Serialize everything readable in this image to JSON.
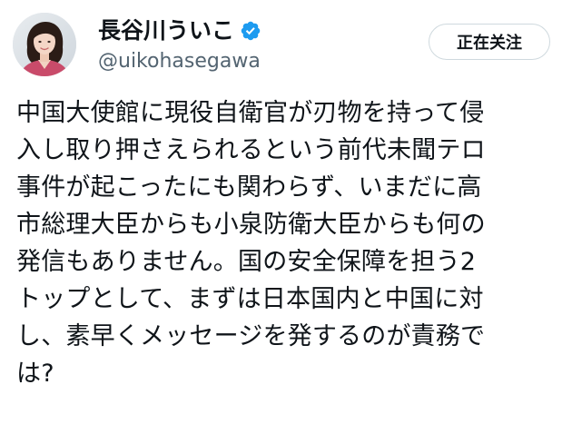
{
  "author": {
    "display_name": "長谷川ういこ",
    "handle": "@uikohasegawa",
    "verified_icon": "verified-badge-icon",
    "verified_color": "#1d9bf0",
    "avatar": "avatar-photo"
  },
  "follow_button": {
    "label": "正在关注"
  },
  "tweet": {
    "lines": [
      "中国大使館に現役自衛官が刃物を持って侵",
      "入し取り押さえられるという前代未聞テロ",
      "事件が起こったにも関わらず、いまだに高",
      "市総理大臣からも小泉防衛大臣からも何の",
      "発信もありません。国の安全保障を担う2",
      "トップとして、まずは日本国内と中国に対",
      "し、素早くメッセージを発するのが責務で",
      "は?"
    ]
  },
  "colors": {
    "text": "#0f1419",
    "secondary": "#536471",
    "border": "#cfd9de",
    "accent": "#1d9bf0"
  }
}
